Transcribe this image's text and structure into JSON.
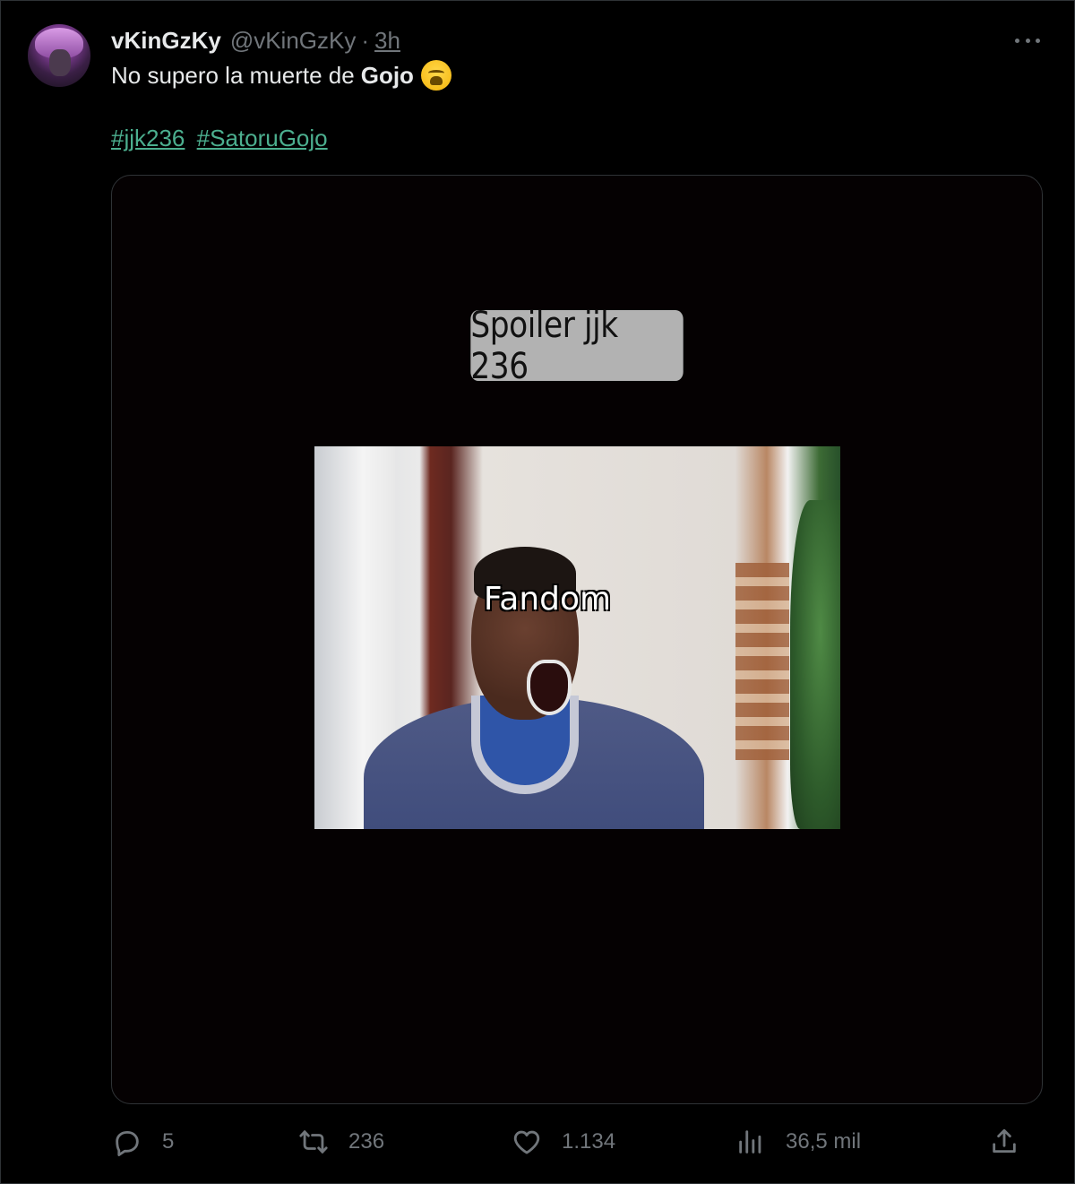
{
  "author": {
    "display_name": "vKinGzKy",
    "handle": "@vKinGzKy",
    "separator": "·",
    "time": "3h"
  },
  "tweet": {
    "text_prefix": "No supero la muerte de",
    "text_bold": "Gojo",
    "emoji": "weary-face-emoji",
    "hashtags": [
      "#jjk236",
      "#SatoruGojo"
    ]
  },
  "media": {
    "caption_top": "Spoiler jjk 236",
    "overlay_label": "Fandom"
  },
  "actions": {
    "replies": "5",
    "retweets": "236",
    "likes": "1.134",
    "views": "36,5 mil"
  },
  "colors": {
    "background": "#000000",
    "text": "#e7e9ea",
    "muted": "#71767b",
    "hashtag": "#4caf8f",
    "border": "#2f3336"
  },
  "icons": [
    "more-icon",
    "reply-icon",
    "retweet-icon",
    "like-icon",
    "views-icon",
    "share-icon"
  ]
}
